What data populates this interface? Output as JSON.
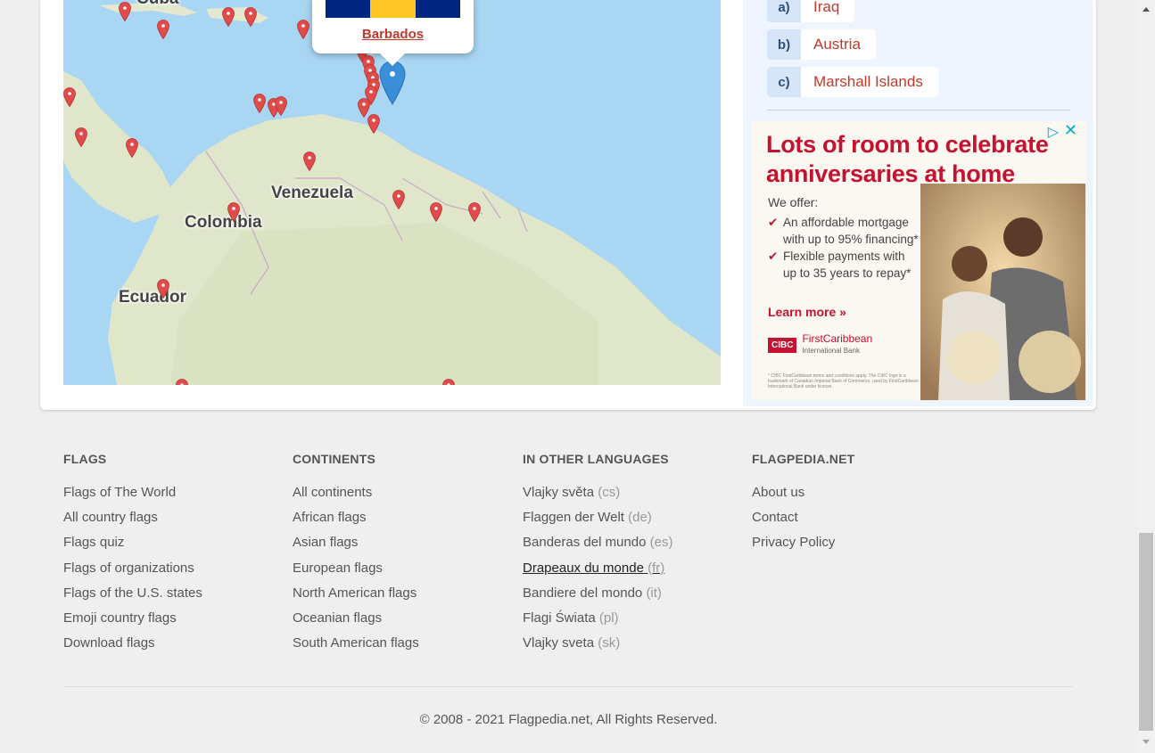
{
  "map": {
    "labels": [
      "Cuba",
      "Venezuela",
      "Colombia",
      "Ecuador"
    ],
    "popup": {
      "country": "Barbados"
    }
  },
  "quiz": {
    "answers": [
      {
        "letter": "a)",
        "name": "Iraq"
      },
      {
        "letter": "b)",
        "name": "Austria"
      },
      {
        "letter": "c)",
        "name": "Marshall Islands"
      }
    ]
  },
  "ad": {
    "headline": "Lots of room to celebrate anniversaries at home",
    "offer_intro": "We offer:",
    "bullets": [
      "An affordable mortgage with up to 95% financing*",
      "Flexible payments with up to 35 years to repay*"
    ],
    "cta": "Learn more",
    "brand_box": "CIBC",
    "brand_name": "FirstCaribbean",
    "brand_sub": "International Bank",
    "fine_print": "* CIBC FirstCaribbean terms and conditions apply. The CIBC logo is a trademark of Canadian Imperial Bank of Commerce, used by FirstCaribbean International Bank under license."
  },
  "footer": {
    "columns": [
      {
        "title": "FLAGS",
        "links": [
          {
            "text": "Flags of The World"
          },
          {
            "text": "All country flags"
          },
          {
            "text": "Flags quiz"
          },
          {
            "text": "Flags of organizations"
          },
          {
            "text": "Flags of the U.S. states"
          },
          {
            "text": "Emoji country flags"
          },
          {
            "text": "Download flags"
          }
        ]
      },
      {
        "title": "CONTINENTS",
        "links": [
          {
            "text": "All continents"
          },
          {
            "text": "African flags"
          },
          {
            "text": "Asian flags"
          },
          {
            "text": "European flags"
          },
          {
            "text": "North American flags"
          },
          {
            "text": "Oceanian flags"
          },
          {
            "text": "South American flags"
          }
        ]
      },
      {
        "title": "IN OTHER LANGUAGES",
        "links": [
          {
            "text": "Vlajky světa",
            "code": "(cs)"
          },
          {
            "text": "Flaggen der Welt",
            "code": "(de)"
          },
          {
            "text": "Banderas del mundo",
            "code": "(es)"
          },
          {
            "text": "Drapeaux du monde",
            "code": "(fr)"
          },
          {
            "text": "Bandiere del mondo",
            "code": "(it)"
          },
          {
            "text": "Flagi Świata",
            "code": "(pl)"
          },
          {
            "text": "Vlajky sveta",
            "code": "(sk)"
          }
        ]
      },
      {
        "title": "FLAGPEDIA.NET",
        "links": [
          {
            "text": "About us"
          },
          {
            "text": "Contact"
          },
          {
            "text": "Privacy Policy"
          }
        ]
      }
    ],
    "copyright": "© 2008 - 2021 Flagpedia.net, All Rights Reserved."
  },
  "colors": {
    "accent": "#c0392b",
    "map_water": "#a9d6f3",
    "map_land": "#dfe6c9",
    "pin": "#e04b4b",
    "selected_pin": "#3a8fd8"
  }
}
